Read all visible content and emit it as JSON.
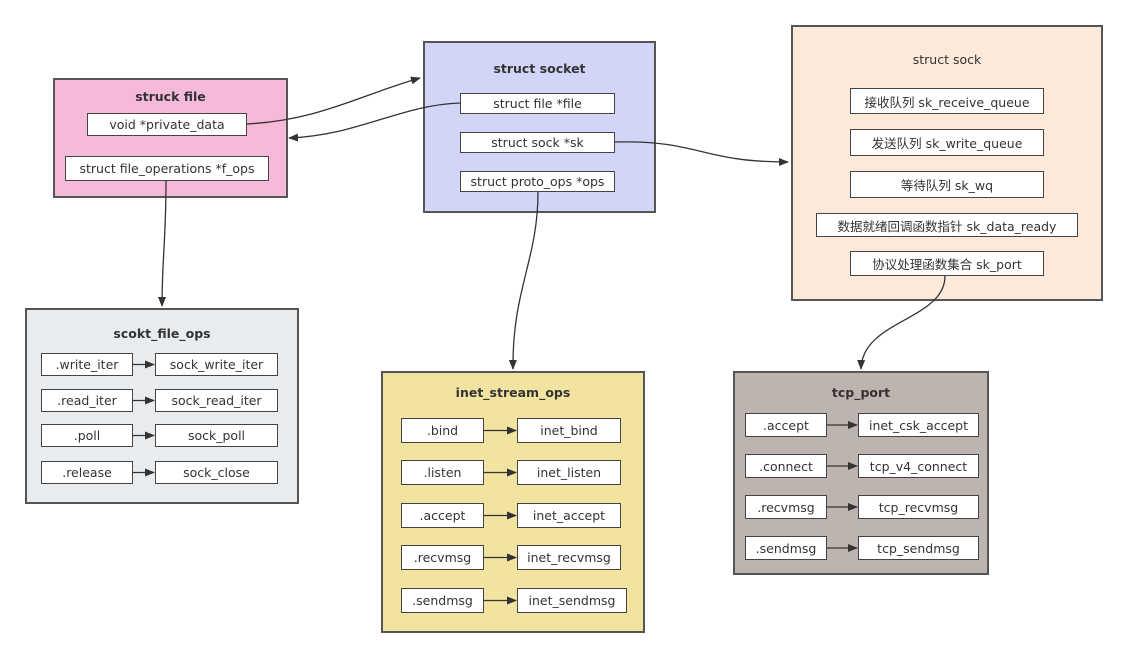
{
  "colors": {
    "struck_file": "#f5b9da",
    "struct_socket": "#d3d5f8",
    "struct_sock": "#fde9da",
    "scokt_file_ops": "#e9ecef",
    "inet_stream_ops": "#f3e3a1",
    "tcp_port": "#beb4af"
  },
  "struck_file": {
    "title": "struck file",
    "fields": [
      "void *private_data",
      "struct file_operations *f_ops"
    ]
  },
  "struct_socket": {
    "title": "struct socket",
    "fields": [
      "struct file *file",
      "struct sock *sk",
      "struct proto_ops *ops"
    ]
  },
  "struct_sock": {
    "title": "struct sock",
    "fields": [
      "接收队列 sk_receive_queue",
      "发送队列 sk_write_queue",
      "等待队列 sk_wq",
      "数据就绪回调函数指针 sk_data_ready",
      "协议处理函数集合 sk_port"
    ]
  },
  "scokt_file_ops": {
    "title": "scokt_file_ops",
    "rows": [
      [
        ".write_iter",
        "sock_write_iter"
      ],
      [
        ".read_iter",
        "sock_read_iter"
      ],
      [
        ".poll",
        "sock_poll"
      ],
      [
        ".release",
        "sock_close"
      ]
    ]
  },
  "inet_stream_ops": {
    "title": "inet_stream_ops",
    "rows": [
      [
        ".bind",
        "inet_bind"
      ],
      [
        ".listen",
        "inet_listen"
      ],
      [
        ".accept",
        "inet_accept"
      ],
      [
        ".recvmsg",
        "inet_recvmsg"
      ],
      [
        ".sendmsg",
        "inet_sendmsg"
      ]
    ]
  },
  "tcp_port": {
    "title": "tcp_port",
    "rows": [
      [
        ".accept",
        "inet_csk_accept"
      ],
      [
        ".connect",
        "tcp_v4_connect"
      ],
      [
        ".recvmsg",
        "tcp_recvmsg"
      ],
      [
        ".sendmsg",
        "tcp_sendmsg"
      ]
    ]
  }
}
